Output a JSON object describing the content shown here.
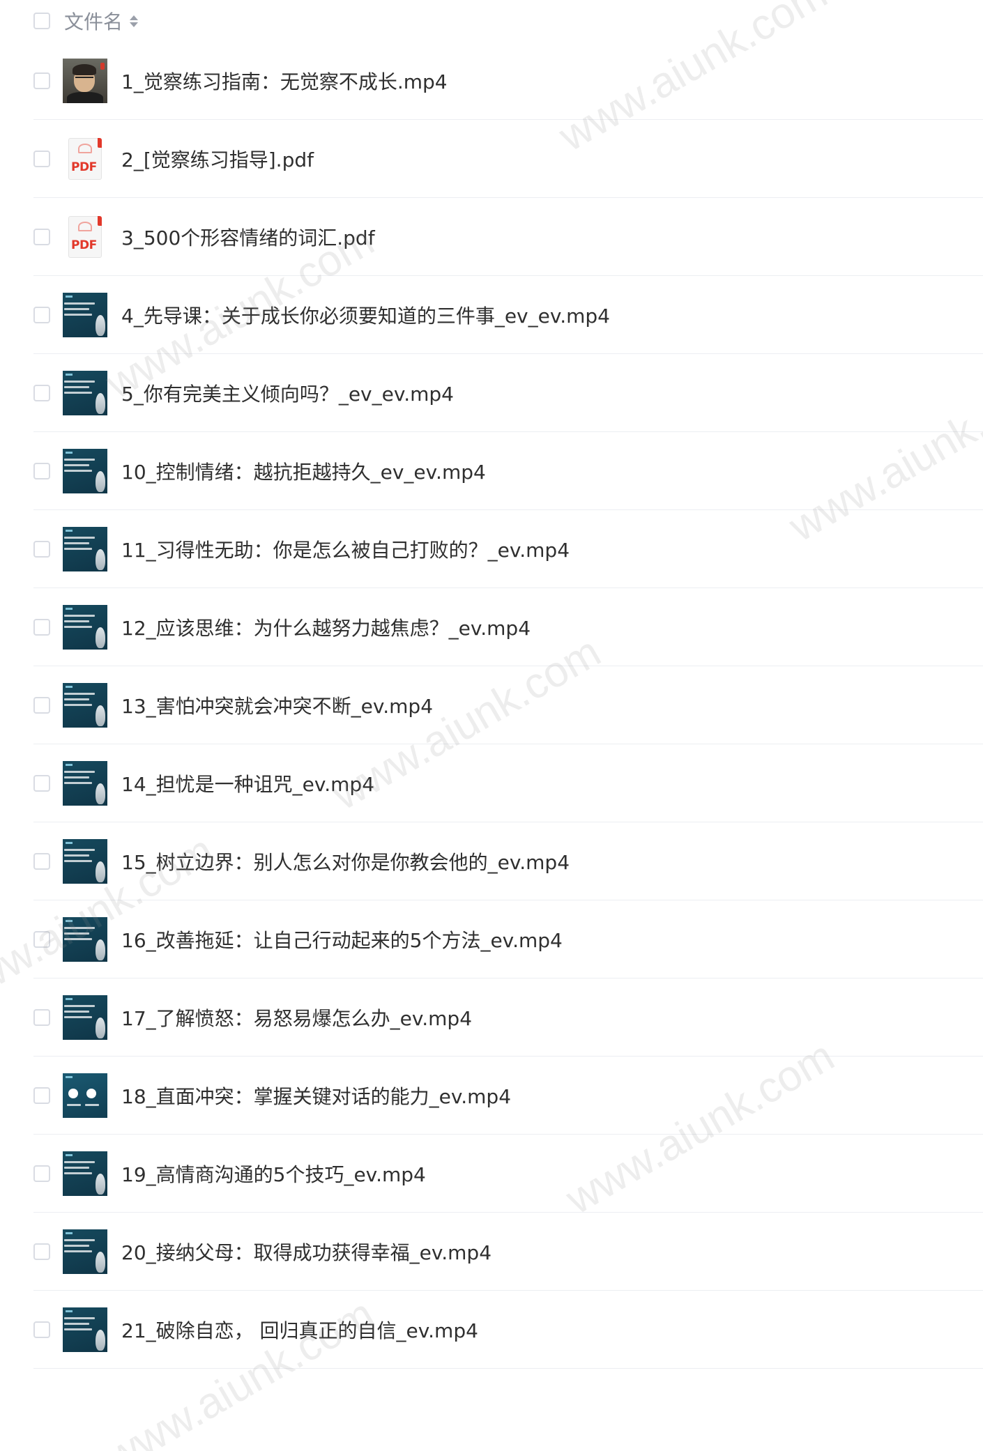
{
  "header": {
    "column_label": "文件名"
  },
  "files": [
    {
      "name": "1_觉察练习指南：无觉察不成长.mp4",
      "thumb": "photo"
    },
    {
      "name": "2_[觉察练习指导].pdf",
      "thumb": "pdf"
    },
    {
      "name": "3_500个形容情绪的词汇.pdf",
      "thumb": "pdf"
    },
    {
      "name": "4_先导课：关于成长你必须要知道的三件事_ev_ev.mp4",
      "thumb": "video"
    },
    {
      "name": "5_你有完美主义倾向吗？_ev_ev.mp4",
      "thumb": "video"
    },
    {
      "name": "10_控制情绪：越抗拒越持久_ev_ev.mp4",
      "thumb": "video"
    },
    {
      "name": "11_习得性无助：你是怎么被自己打败的？_ev.mp4",
      "thumb": "video"
    },
    {
      "name": "12_应该思维：为什么越努力越焦虑？_ev.mp4",
      "thumb": "video"
    },
    {
      "name": "13_害怕冲突就会冲突不断_ev.mp4",
      "thumb": "video"
    },
    {
      "name": "14_担忧是一种诅咒_ev.mp4",
      "thumb": "video"
    },
    {
      "name": "15_树立边界：别人怎么对你是你教会他的_ev.mp4",
      "thumb": "video"
    },
    {
      "name": "16_改善拖延：让自己行动起来的5个方法_ev.mp4",
      "thumb": "video"
    },
    {
      "name": "17_了解愤怒：易怒易爆怎么办_ev.mp4",
      "thumb": "video"
    },
    {
      "name": "18_直面冲突：掌握关键对话的能力_ev.mp4",
      "thumb": "video-alt"
    },
    {
      "name": "19_高情商沟通的5个技巧_ev.mp4",
      "thumb": "video"
    },
    {
      "name": "20_接纳父母：取得成功获得幸福_ev.mp4",
      "thumb": "video"
    },
    {
      "name": "21_破除自恋， 回归真正的自信_ev.mp4",
      "thumb": "video"
    }
  ],
  "pdf_label": "PDF",
  "watermark_text": "www.aiunk.com",
  "colors": {
    "pdf_red": "#e2382a",
    "video_thumb": "#164a5e",
    "row_divider": "#eceef2",
    "header_text": "#8a8f99"
  }
}
